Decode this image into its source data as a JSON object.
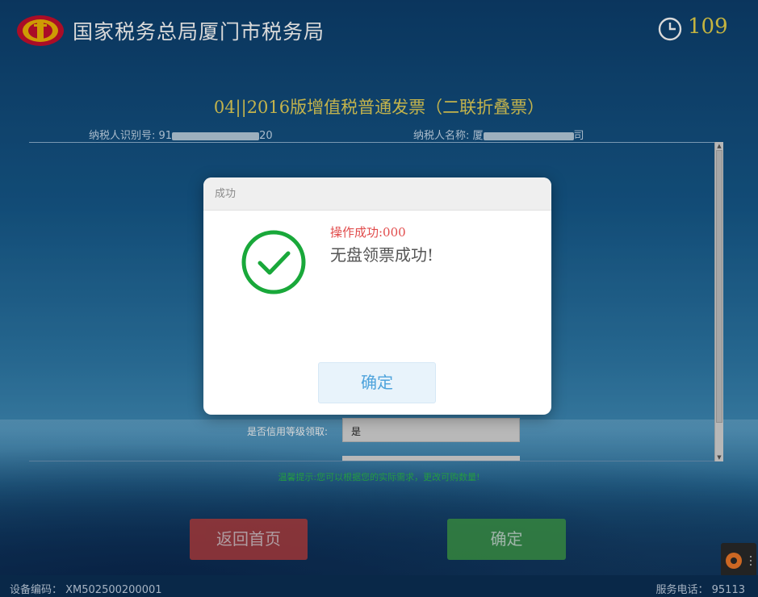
{
  "header": {
    "bureau_title": "国家税务总局厦门市税务局",
    "timer_value": "109"
  },
  "invoice": {
    "title": "04||2016版增值税普通发票（二联折叠票）",
    "taxpayer_id_label": "纳税人识别号:",
    "taxpayer_id_prefix": "91",
    "taxpayer_id_suffix": "20",
    "taxpayer_name_label": "纳税人名称:",
    "taxpayer_name_prefix": "厦",
    "taxpayer_name_suffix": "司"
  },
  "form": {
    "credit_label": "是否信用等级领取:",
    "credit_value": "是",
    "tip": "温馨提示:您可以根据您的实际需求，更改可购数量!"
  },
  "buttons": {
    "home_label": "返回首页",
    "confirm_label": "确定"
  },
  "footer": {
    "device_code": "设备编码： XM502500200001",
    "service_phone": "服务电话： 95113"
  },
  "dialog": {
    "header": "成功",
    "op_code": "操作成功:000",
    "message": "无盘领票成功!",
    "ok_label": "确定",
    "icon": "check-circle-icon",
    "icon_color": "#19a83a"
  },
  "colors": {
    "accent_gold": "#e6d35a",
    "home_button": "#b84040",
    "confirm_button": "#3f9d4a"
  }
}
